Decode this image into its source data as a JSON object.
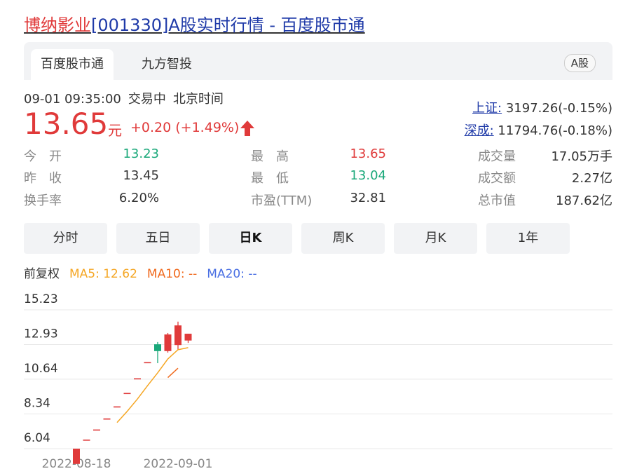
{
  "title": {
    "name": "博纳影业",
    "rest": "[001330]A股实时行情 - 百度股市通"
  },
  "tabs": [
    {
      "label": "百度股市通",
      "active": true
    },
    {
      "label": "九方智投",
      "active": false
    }
  ],
  "market_badge": "A股",
  "status": {
    "time": "09-01 09:35:00",
    "state": "交易中",
    "zone": "北京时间"
  },
  "quote": {
    "price": "13.65",
    "unit": "元",
    "change": "+0.20 (+1.49%)",
    "direction": "up",
    "up_color": "#e03a3a",
    "down_color": "#1aa87a"
  },
  "indices": [
    {
      "label": "上证:",
      "value": "3197.26(-0.15%)"
    },
    {
      "label": "深成:",
      "value": "11794.76(-0.18%)"
    }
  ],
  "stats": [
    {
      "label": "今　开",
      "value": "13.23",
      "color": "green"
    },
    {
      "label": "昨　收",
      "value": "13.45",
      "color": "dark"
    },
    {
      "label": "换手率",
      "value": "6.20%",
      "color": "dark"
    },
    {
      "label": "最　高",
      "value": "13.65",
      "color": "red"
    },
    {
      "label": "最　低",
      "value": "13.04",
      "color": "green"
    },
    {
      "label": "市盈(TTM)",
      "value": "32.81",
      "color": "dark"
    },
    {
      "label": "成交量",
      "value": "17.05万手",
      "color": "dark"
    },
    {
      "label": "成交额",
      "value": "2.27亿",
      "color": "dark"
    },
    {
      "label": "总市值",
      "value": "187.62亿",
      "color": "dark"
    }
  ],
  "periods": [
    {
      "label": "分时",
      "active": false
    },
    {
      "label": "五日",
      "active": false
    },
    {
      "label": "日K",
      "active": true
    },
    {
      "label": "周K",
      "active": false
    },
    {
      "label": "月K",
      "active": false
    },
    {
      "label": "1年",
      "active": false
    }
  ],
  "legend": {
    "adjust": "前复权",
    "ma5": "MA5: 12.62",
    "ma10": "MA10: --",
    "ma20": "MA20: --",
    "ma5_color": "#f5a623",
    "ma10_color": "#f06a1e",
    "ma20_color": "#4a6fe3"
  },
  "chart_data": {
    "type": "candlestick",
    "y_ticks": [
      "15.23",
      "12.93",
      "10.64",
      "8.34",
      "6.04"
    ],
    "ylim": [
      5.0,
      16.0
    ],
    "x_labels": [
      {
        "index": 0,
        "label": "2022-08-18"
      },
      {
        "index": 10,
        "label": "2022-09-01"
      }
    ],
    "candles": [
      {
        "o": 5.03,
        "h": 6.04,
        "c": 6.04,
        "l": 5.03
      },
      {
        "o": 6.64,
        "h": 6.64,
        "c": 6.64,
        "l": 6.64
      },
      {
        "o": 7.31,
        "h": 7.31,
        "c": 7.31,
        "l": 7.31
      },
      {
        "o": 8.04,
        "h": 8.04,
        "c": 8.04,
        "l": 8.04
      },
      {
        "o": 8.84,
        "h": 8.84,
        "c": 8.84,
        "l": 8.84
      },
      {
        "o": 9.73,
        "h": 9.73,
        "c": 9.73,
        "l": 9.73
      },
      {
        "o": 10.7,
        "h": 10.7,
        "c": 10.7,
        "l": 10.7
      },
      {
        "o": 11.77,
        "h": 11.77,
        "c": 11.77,
        "l": 11.77
      },
      {
        "o": 12.95,
        "h": 13.1,
        "c": 12.5,
        "l": 11.7
      },
      {
        "o": 12.5,
        "h": 13.7,
        "c": 13.6,
        "l": 12.4
      },
      {
        "o": 12.9,
        "h": 14.45,
        "c": 14.2,
        "l": 12.6
      },
      {
        "o": 13.2,
        "h": 13.65,
        "c": 13.65,
        "l": 13.04
      }
    ],
    "ma5": [
      null,
      null,
      null,
      null,
      7.77,
      8.51,
      9.32,
      10.21,
      11.06,
      11.98,
      12.59,
      12.73
    ],
    "ma10": [
      null,
      null,
      null,
      null,
      null,
      null,
      null,
      null,
      null,
      10.75,
      11.37,
      null
    ]
  }
}
